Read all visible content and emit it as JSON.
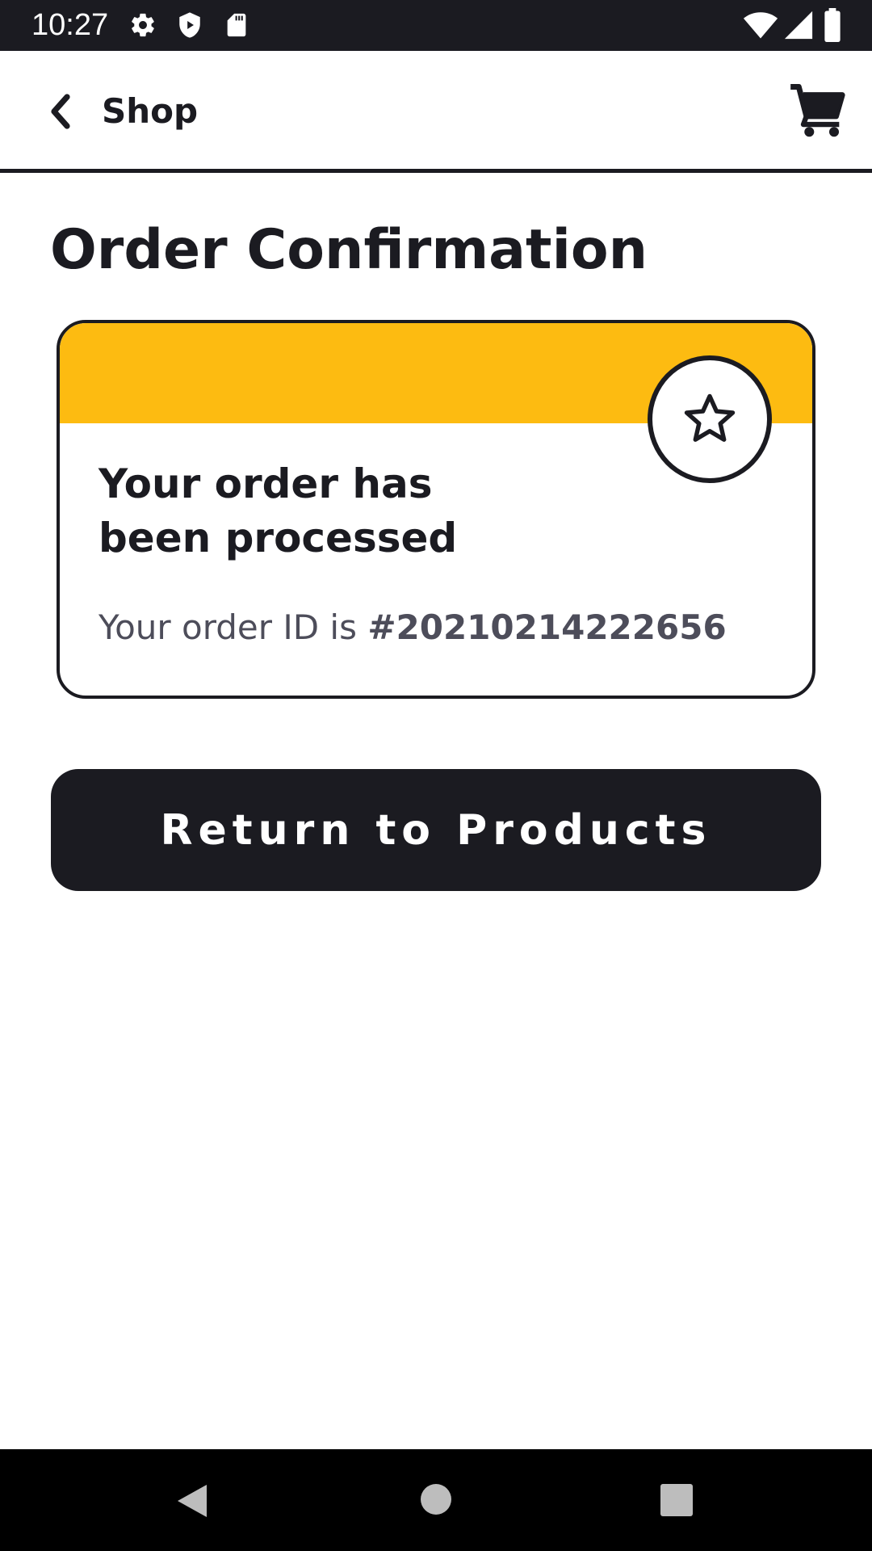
{
  "status_bar": {
    "time": "10:27",
    "left_icons": [
      "settings-gear-icon",
      "shield-icon",
      "sd-card-icon"
    ],
    "right_icons": [
      "wifi-icon",
      "signal-icon",
      "battery-icon"
    ]
  },
  "app_bar": {
    "title": "Shop",
    "back_icon": "chevron-left-icon",
    "cart_icon": "shopping-cart-icon"
  },
  "page": {
    "title": "Order Confirmation"
  },
  "card": {
    "heading": "Your order has been processed",
    "order_id_prefix": "Your order ID is ",
    "order_id": "#20210214222656",
    "badge_icon": "star-outline-icon"
  },
  "primary_action": {
    "label": "Return to Products"
  },
  "nav_bar": {
    "icons": [
      "back-triangle-icon",
      "home-circle-icon",
      "recents-square-icon"
    ]
  },
  "colors": {
    "dark": "#1b1b21",
    "accent_yellow": "#fdbb11",
    "muted_text": "#4d4d5a",
    "background": "#ffffff"
  }
}
